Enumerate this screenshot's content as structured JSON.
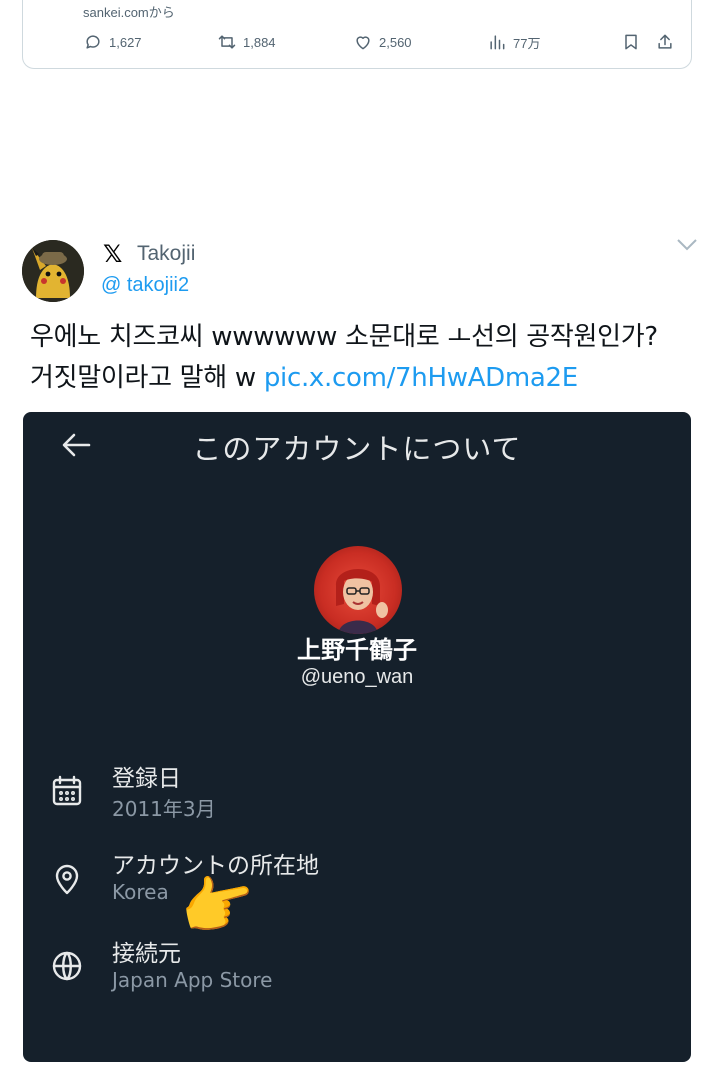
{
  "top_card": {
    "source": "sankei.comから",
    "reply_count": "1,627",
    "retweet_count": "1,884",
    "like_count": "2,560",
    "view_count": "77万"
  },
  "tweet": {
    "display_name": "Takojii",
    "handle": "@ takojii2",
    "text_line1": "우에노 치즈코씨 wwwwww 소문대로 ㅗ선의 공작원인가?",
    "text_line2": "거짓말이라고 말해 w ",
    "link": "pic.x.com/7hHwADma2E"
  },
  "screenshot": {
    "title": "このアカウントについて",
    "profile_name": "上野千鶴子",
    "profile_handle": "@ueno_wan",
    "rows": [
      {
        "label": "登録日",
        "value": "2011年3月",
        "icon": "calendar-icon"
      },
      {
        "label": "アカウントの所在地",
        "value": "Korea",
        "icon": "location-pin-icon"
      },
      {
        "label": "接続元",
        "value": "Japan App Store",
        "icon": "globe-icon"
      }
    ],
    "annotation_emoji": "👉"
  },
  "colors": {
    "link_blue": "#1d9bf0",
    "dark_bg": "#15202b",
    "muted_text": "#536471"
  }
}
